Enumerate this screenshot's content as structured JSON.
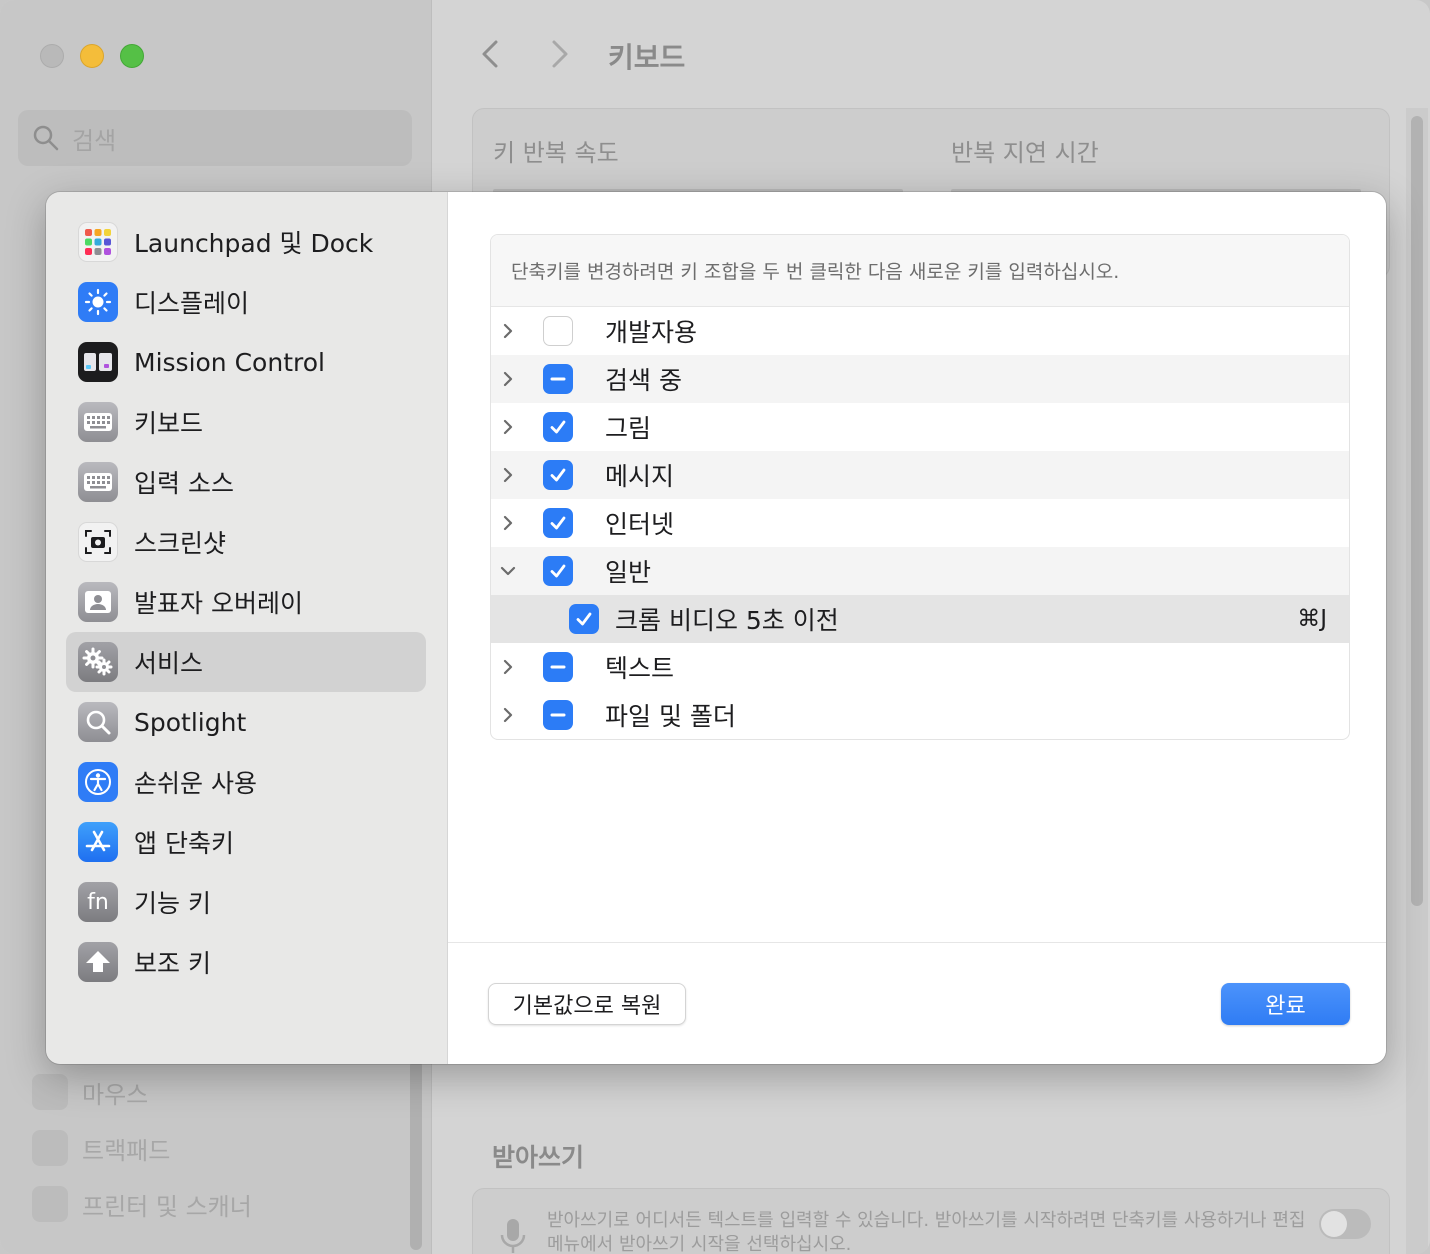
{
  "window": {
    "title": "키보드",
    "search_placeholder": "검색"
  },
  "background": {
    "key_repeat_label": "키 반복 속도",
    "repeat_delay_label": "반복 지연 시간",
    "sidebar_visible_items": [
      "마우스",
      "트랙패드",
      "프린터 및 스캐너"
    ],
    "dictation_title": "받아쓰기",
    "dictation_desc": "받아쓰기로 어디서든 텍스트를 입력할 수 있습니다. 받아쓰기를 시작하려면 단축키를 사용하거나 편집 메뉴에서 받아쓰기 시작을 선택하십시오.",
    "dictation_enabled": false
  },
  "sheet": {
    "categories": [
      {
        "label": "Launchpad 및 Dock",
        "icon": "launchpad-icon"
      },
      {
        "label": "디스플레이",
        "icon": "display-brightness-icon"
      },
      {
        "label": "Mission Control",
        "icon": "mission-control-icon"
      },
      {
        "label": "키보드",
        "icon": "keyboard-icon"
      },
      {
        "label": "입력 소스",
        "icon": "input-source-icon"
      },
      {
        "label": "스크린샷",
        "icon": "screenshot-icon"
      },
      {
        "label": "발표자 오버레이",
        "icon": "presenter-overlay-icon"
      },
      {
        "label": "서비스",
        "icon": "services-gears-icon",
        "selected": true
      },
      {
        "label": "Spotlight",
        "icon": "spotlight-search-icon"
      },
      {
        "label": "손쉬운 사용",
        "icon": "accessibility-icon"
      },
      {
        "label": "앱 단축키",
        "icon": "app-store-icon"
      },
      {
        "label": "기능 키",
        "icon": "fn-key-icon"
      },
      {
        "label": "보조 키",
        "icon": "modifier-key-icon"
      }
    ],
    "hint": "단축키를 변경하려면 키 조합을 두 번 클릭한 다음 새로운 키를 입력하십시오.",
    "rows": [
      {
        "label": "개발자용",
        "state": "off",
        "expanded": false
      },
      {
        "label": "검색 중",
        "state": "mixed",
        "expanded": false
      },
      {
        "label": "그림",
        "state": "on",
        "expanded": false
      },
      {
        "label": "메시지",
        "state": "on",
        "expanded": false
      },
      {
        "label": "인터넷",
        "state": "on",
        "expanded": false
      },
      {
        "label": "일반",
        "state": "on",
        "expanded": true
      },
      {
        "label": "크롬 비디오 5초 이전",
        "state": "on",
        "child": true,
        "shortcut": "⌘J"
      },
      {
        "label": "텍스트",
        "state": "mixed",
        "expanded": false
      },
      {
        "label": "파일 및 폴더",
        "state": "mixed",
        "expanded": false
      }
    ],
    "restore_label": "기본값으로 복원",
    "done_label": "완료"
  },
  "colors": {
    "accent": "#2c7cf6",
    "selected_row": "#d2d2d2"
  }
}
